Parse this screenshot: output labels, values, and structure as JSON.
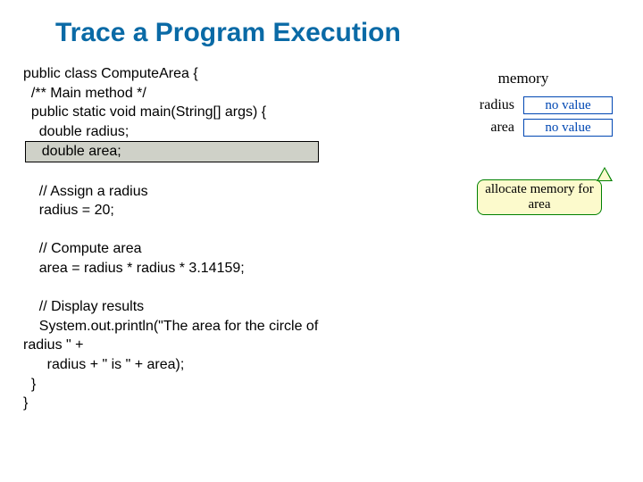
{
  "title": "Trace a Program Execution",
  "code": {
    "l1": "public class ComputeArea { ",
    "l2": "  /** Main method */",
    "l3": "  public static void main(String[] args) {",
    "l4": "    double radius;",
    "l5_hl": "    double area;",
    "l6": "    // Assign a radius",
    "l7": "    radius = 20;",
    "l8": "    // Compute area",
    "l9": "    area = radius * radius * 3.14159;",
    "l10": "    // Display results",
    "l11a": "    System.out.println(\"The area for the circle of",
    "l11b": "radius \" +",
    "l12": "      radius + \" is \" + area);",
    "l13": "  } ",
    "l14": "} "
  },
  "memory": {
    "heading": "memory",
    "rows": [
      {
        "label": "radius",
        "value": "no value"
      },
      {
        "label": "area",
        "value": "no value"
      }
    ]
  },
  "callout": "allocate memory for area"
}
